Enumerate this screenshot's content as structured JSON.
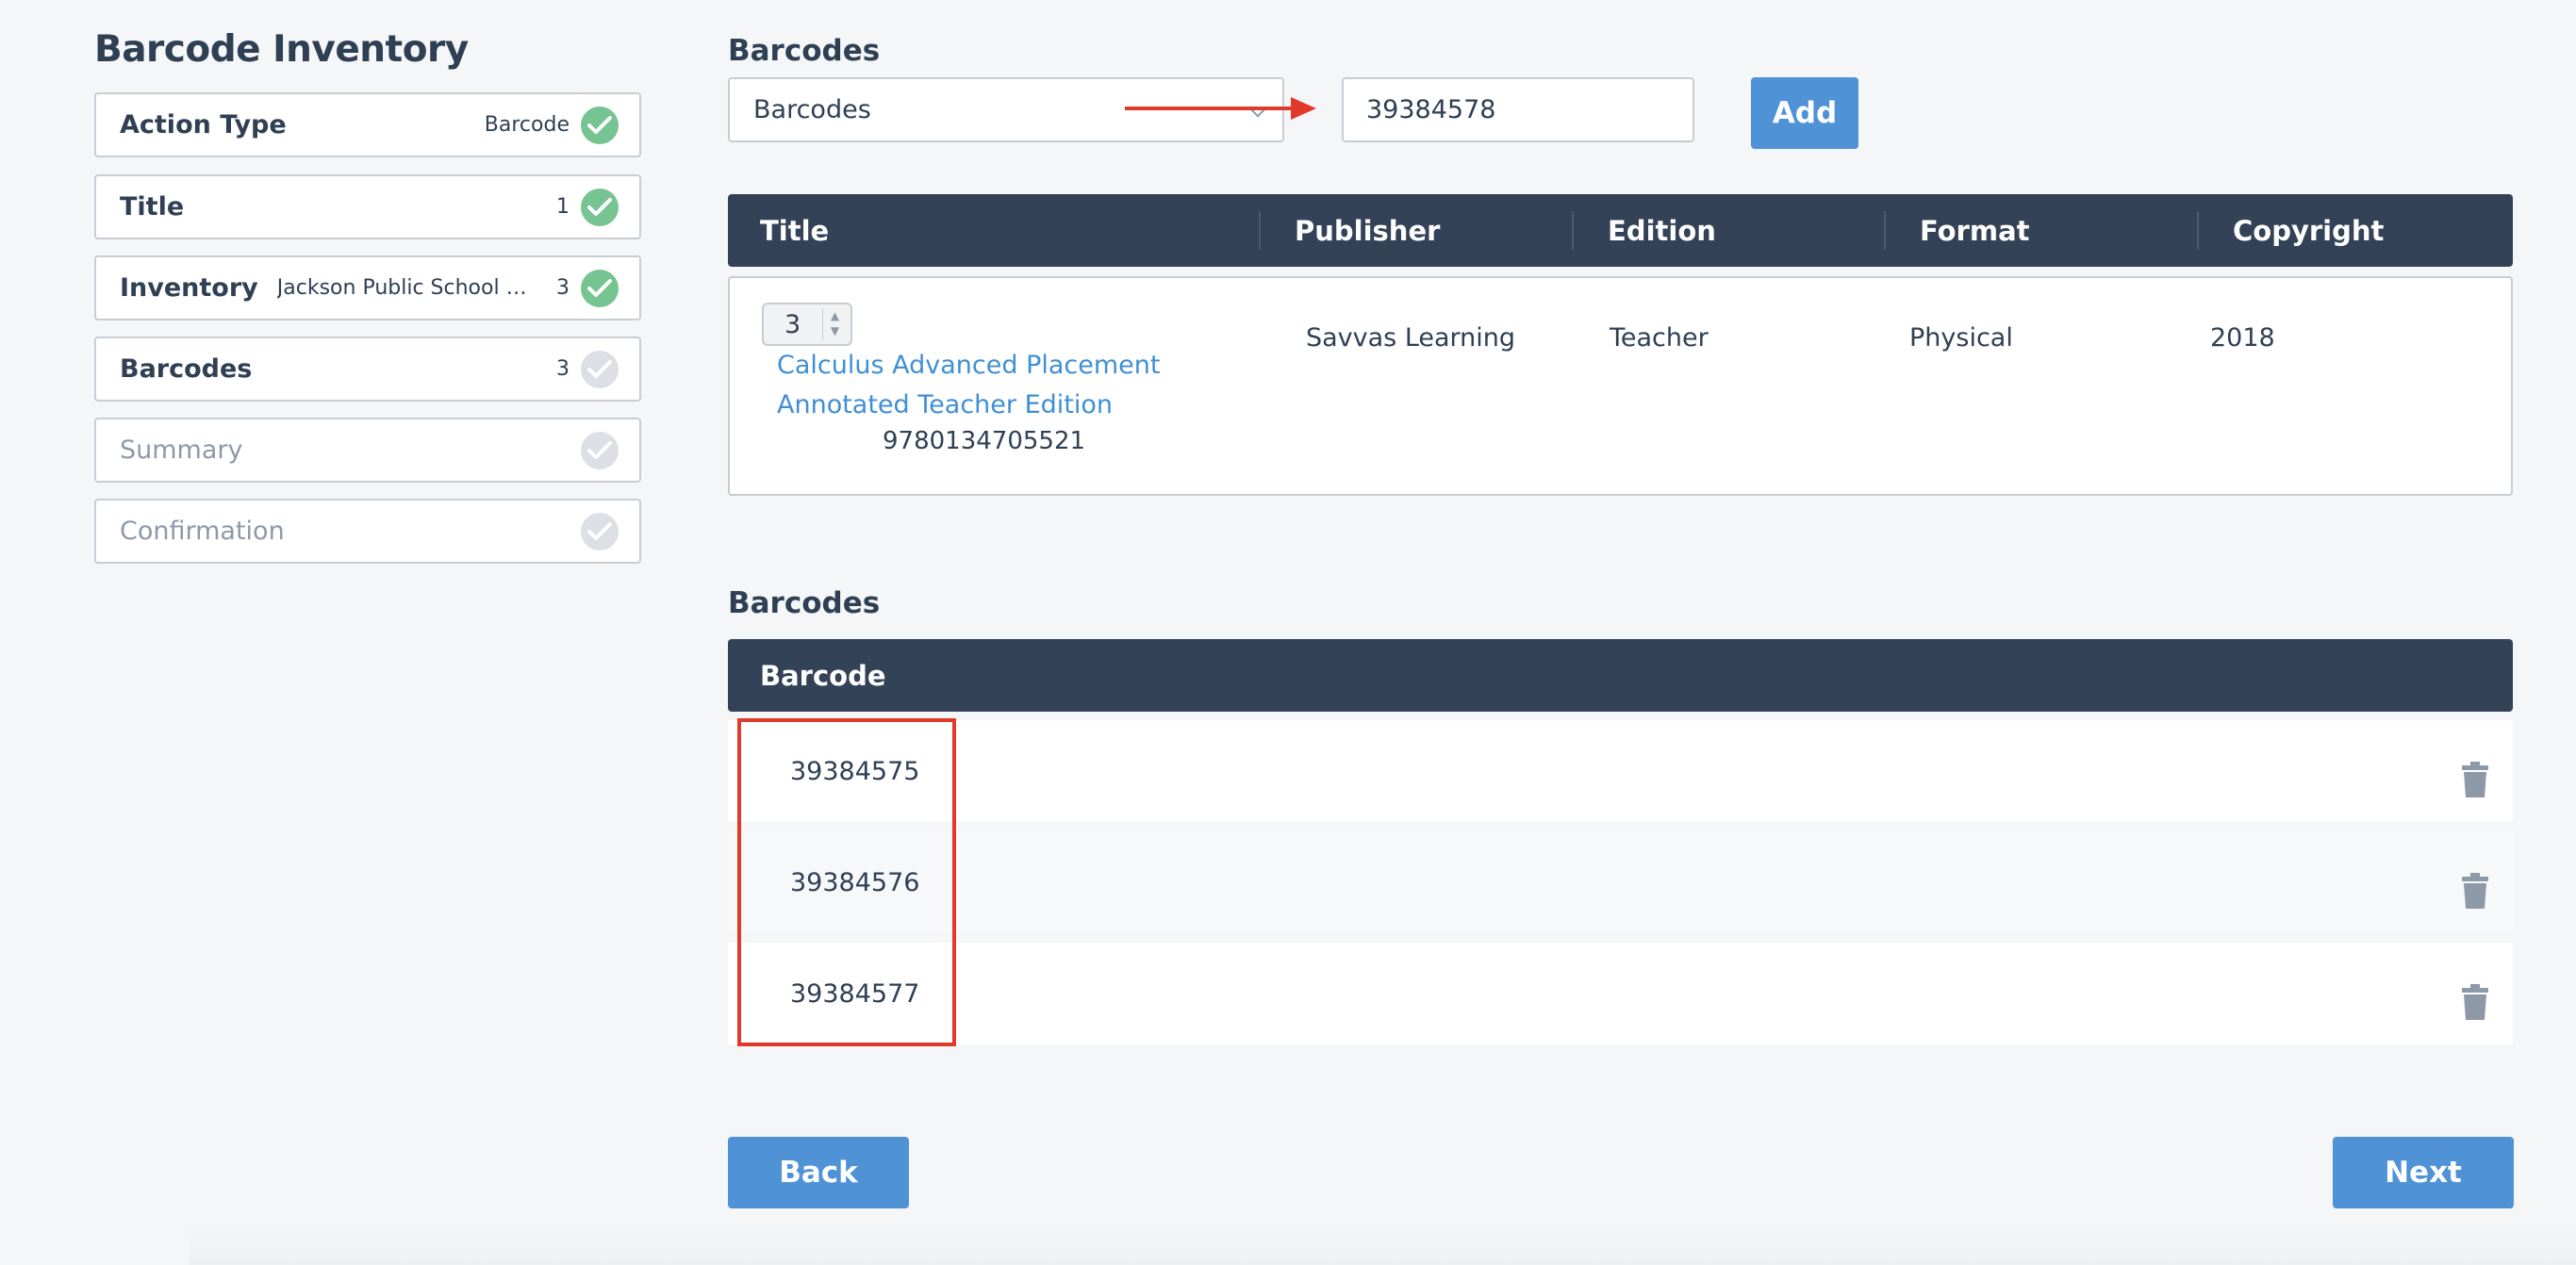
{
  "sidebar": {
    "title": "Barcode Inventory",
    "steps": [
      {
        "label": "Action Type",
        "value": "Barcode",
        "count": "",
        "status": "done"
      },
      {
        "label": "Title",
        "value": "",
        "count": "1",
        "status": "done"
      },
      {
        "label": "Inventory",
        "value": "Jackson Public School Di...",
        "count": "3",
        "status": "done"
      },
      {
        "label": "Barcodes",
        "value": "",
        "count": "3",
        "status": "pending"
      },
      {
        "label": "Summary",
        "value": "",
        "count": "",
        "status": "inactive"
      },
      {
        "label": "Confirmation",
        "value": "",
        "count": "",
        "status": "inactive"
      }
    ]
  },
  "add_section": {
    "label": "Barcodes",
    "select_value": "Barcodes",
    "input_value": "39384578",
    "add_label": "Add"
  },
  "title_table": {
    "headers": [
      "Title",
      "Publisher",
      "Edition",
      "Format",
      "Copyright"
    ],
    "row": {
      "quantity": "3",
      "title": "Calculus Advanced Placement Annotated Teacher Edition",
      "isbn": "9780134705521",
      "publisher": "Savvas Learning",
      "edition": "Teacher",
      "format": "Physical",
      "copyright": "2018"
    }
  },
  "barcodes_section": {
    "label": "Barcodes",
    "header": "Barcode",
    "items": [
      "39384575",
      "39384576",
      "39384577"
    ]
  },
  "footer": {
    "back_label": "Back",
    "next_label": "Next"
  },
  "colors": {
    "accent": "#4f92d6",
    "header_bg": "#344257",
    "check_done": "#77c493",
    "check_pending": "#dce0e5",
    "annotation": "#e03a2b",
    "link": "#3f8fd6"
  }
}
